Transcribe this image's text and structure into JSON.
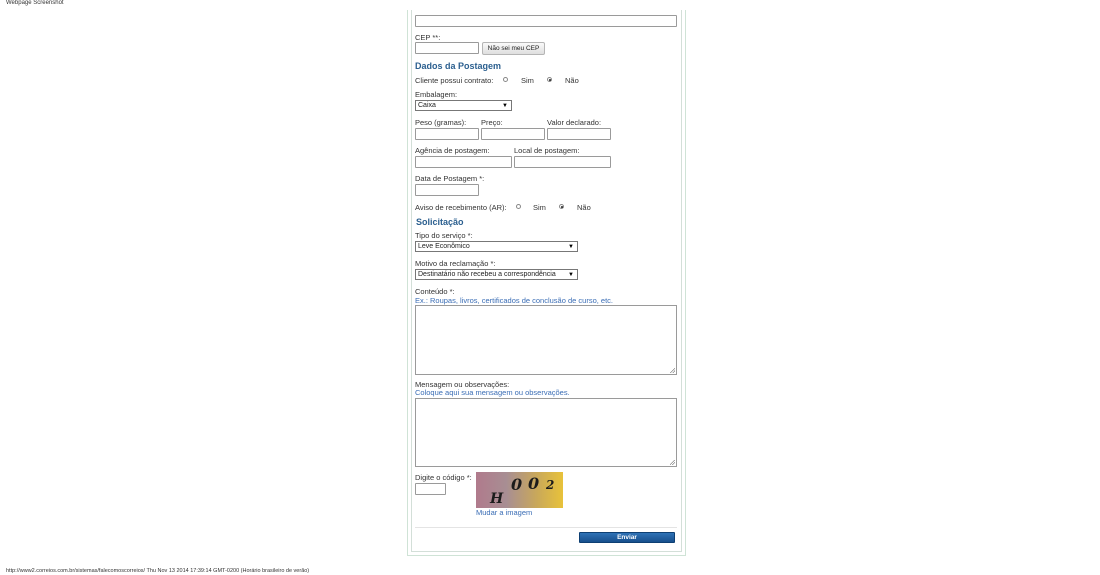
{
  "screenshot": {
    "title": "Webpage Screenshot"
  },
  "footer": {
    "text": "http://www2.correios.com.br/sistemas/falecomoscorreios/ Thu Nov 13 2014 17:39:14 GMT-0200 (Horário brasileiro de verão)"
  },
  "form": {
    "cep": {
      "label": "CEP **:",
      "button": "Não sei meu CEP"
    },
    "postagem": {
      "heading": "Dados da Postagem",
      "contrato": {
        "label": "Cliente possui contrato:",
        "sim": "Sim",
        "nao": "Não",
        "selected": "nao"
      },
      "embalagem": {
        "label": "Embalagem:",
        "value": "Caixa"
      },
      "peso": {
        "label": "Peso (gramas):"
      },
      "preco": {
        "label": "Preço:"
      },
      "valor": {
        "label": "Valor declarado:"
      },
      "agencia": {
        "label": "Agência de postagem:"
      },
      "local": {
        "label": "Local de postagem:"
      },
      "data": {
        "label": "Data de Postagem *:"
      },
      "aviso": {
        "label": "Aviso de recebimento (AR):",
        "sim": "Sim",
        "nao": "Não",
        "selected": "nao"
      }
    },
    "solicitacao": {
      "heading": "Solicitação",
      "tipo": {
        "label": "Tipo do serviço *:",
        "value": "Leve Econômico"
      },
      "motivo": {
        "label": "Motivo da reclamação *:",
        "value": "Destinatário não recebeu a correspondência"
      },
      "conteudo": {
        "label": "Conteúdo *:",
        "hint": "Ex.: Roupas, livros, certificados de conclusão de curso, etc."
      },
      "mensagem": {
        "label": "Mensagem ou observações:",
        "hint": "Coloque aqui sua mensagem ou observações."
      }
    },
    "captcha": {
      "label": "Digite o código *:",
      "chars": [
        "H",
        "0",
        "0",
        "2"
      ],
      "change_link": "Mudar a imagem"
    },
    "submit": "Enviar"
  },
  "icons": {
    "dropdown": "chevron-down-icon",
    "resize": "resize-handle-icon"
  }
}
